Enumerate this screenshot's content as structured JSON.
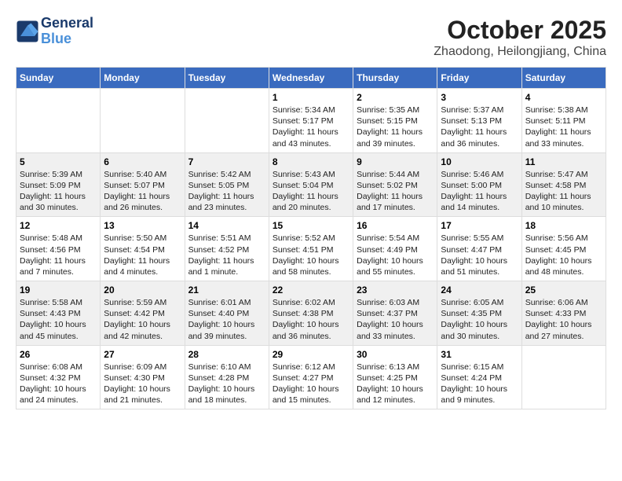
{
  "logo": {
    "line1": "General",
    "line2": "Blue"
  },
  "title": "October 2025",
  "subtitle": "Zhaodong, Heilongjiang, China",
  "days_of_week": [
    "Sunday",
    "Monday",
    "Tuesday",
    "Wednesday",
    "Thursday",
    "Friday",
    "Saturday"
  ],
  "weeks": [
    [
      {
        "day": "",
        "content": ""
      },
      {
        "day": "",
        "content": ""
      },
      {
        "day": "",
        "content": ""
      },
      {
        "day": "1",
        "content": "Sunrise: 5:34 AM\nSunset: 5:17 PM\nDaylight: 11 hours and 43 minutes."
      },
      {
        "day": "2",
        "content": "Sunrise: 5:35 AM\nSunset: 5:15 PM\nDaylight: 11 hours and 39 minutes."
      },
      {
        "day": "3",
        "content": "Sunrise: 5:37 AM\nSunset: 5:13 PM\nDaylight: 11 hours and 36 minutes."
      },
      {
        "day": "4",
        "content": "Sunrise: 5:38 AM\nSunset: 5:11 PM\nDaylight: 11 hours and 33 minutes."
      }
    ],
    [
      {
        "day": "5",
        "content": "Sunrise: 5:39 AM\nSunset: 5:09 PM\nDaylight: 11 hours and 30 minutes."
      },
      {
        "day": "6",
        "content": "Sunrise: 5:40 AM\nSunset: 5:07 PM\nDaylight: 11 hours and 26 minutes."
      },
      {
        "day": "7",
        "content": "Sunrise: 5:42 AM\nSunset: 5:05 PM\nDaylight: 11 hours and 23 minutes."
      },
      {
        "day": "8",
        "content": "Sunrise: 5:43 AM\nSunset: 5:04 PM\nDaylight: 11 hours and 20 minutes."
      },
      {
        "day": "9",
        "content": "Sunrise: 5:44 AM\nSunset: 5:02 PM\nDaylight: 11 hours and 17 minutes."
      },
      {
        "day": "10",
        "content": "Sunrise: 5:46 AM\nSunset: 5:00 PM\nDaylight: 11 hours and 14 minutes."
      },
      {
        "day": "11",
        "content": "Sunrise: 5:47 AM\nSunset: 4:58 PM\nDaylight: 11 hours and 10 minutes."
      }
    ],
    [
      {
        "day": "12",
        "content": "Sunrise: 5:48 AM\nSunset: 4:56 PM\nDaylight: 11 hours and 7 minutes."
      },
      {
        "day": "13",
        "content": "Sunrise: 5:50 AM\nSunset: 4:54 PM\nDaylight: 11 hours and 4 minutes."
      },
      {
        "day": "14",
        "content": "Sunrise: 5:51 AM\nSunset: 4:52 PM\nDaylight: 11 hours and 1 minute."
      },
      {
        "day": "15",
        "content": "Sunrise: 5:52 AM\nSunset: 4:51 PM\nDaylight: 10 hours and 58 minutes."
      },
      {
        "day": "16",
        "content": "Sunrise: 5:54 AM\nSunset: 4:49 PM\nDaylight: 10 hours and 55 minutes."
      },
      {
        "day": "17",
        "content": "Sunrise: 5:55 AM\nSunset: 4:47 PM\nDaylight: 10 hours and 51 minutes."
      },
      {
        "day": "18",
        "content": "Sunrise: 5:56 AM\nSunset: 4:45 PM\nDaylight: 10 hours and 48 minutes."
      }
    ],
    [
      {
        "day": "19",
        "content": "Sunrise: 5:58 AM\nSunset: 4:43 PM\nDaylight: 10 hours and 45 minutes."
      },
      {
        "day": "20",
        "content": "Sunrise: 5:59 AM\nSunset: 4:42 PM\nDaylight: 10 hours and 42 minutes."
      },
      {
        "day": "21",
        "content": "Sunrise: 6:01 AM\nSunset: 4:40 PM\nDaylight: 10 hours and 39 minutes."
      },
      {
        "day": "22",
        "content": "Sunrise: 6:02 AM\nSunset: 4:38 PM\nDaylight: 10 hours and 36 minutes."
      },
      {
        "day": "23",
        "content": "Sunrise: 6:03 AM\nSunset: 4:37 PM\nDaylight: 10 hours and 33 minutes."
      },
      {
        "day": "24",
        "content": "Sunrise: 6:05 AM\nSunset: 4:35 PM\nDaylight: 10 hours and 30 minutes."
      },
      {
        "day": "25",
        "content": "Sunrise: 6:06 AM\nSunset: 4:33 PM\nDaylight: 10 hours and 27 minutes."
      }
    ],
    [
      {
        "day": "26",
        "content": "Sunrise: 6:08 AM\nSunset: 4:32 PM\nDaylight: 10 hours and 24 minutes."
      },
      {
        "day": "27",
        "content": "Sunrise: 6:09 AM\nSunset: 4:30 PM\nDaylight: 10 hours and 21 minutes."
      },
      {
        "day": "28",
        "content": "Sunrise: 6:10 AM\nSunset: 4:28 PM\nDaylight: 10 hours and 18 minutes."
      },
      {
        "day": "29",
        "content": "Sunrise: 6:12 AM\nSunset: 4:27 PM\nDaylight: 10 hours and 15 minutes."
      },
      {
        "day": "30",
        "content": "Sunrise: 6:13 AM\nSunset: 4:25 PM\nDaylight: 10 hours and 12 minutes."
      },
      {
        "day": "31",
        "content": "Sunrise: 6:15 AM\nSunset: 4:24 PM\nDaylight: 10 hours and 9 minutes."
      },
      {
        "day": "",
        "content": ""
      }
    ]
  ]
}
